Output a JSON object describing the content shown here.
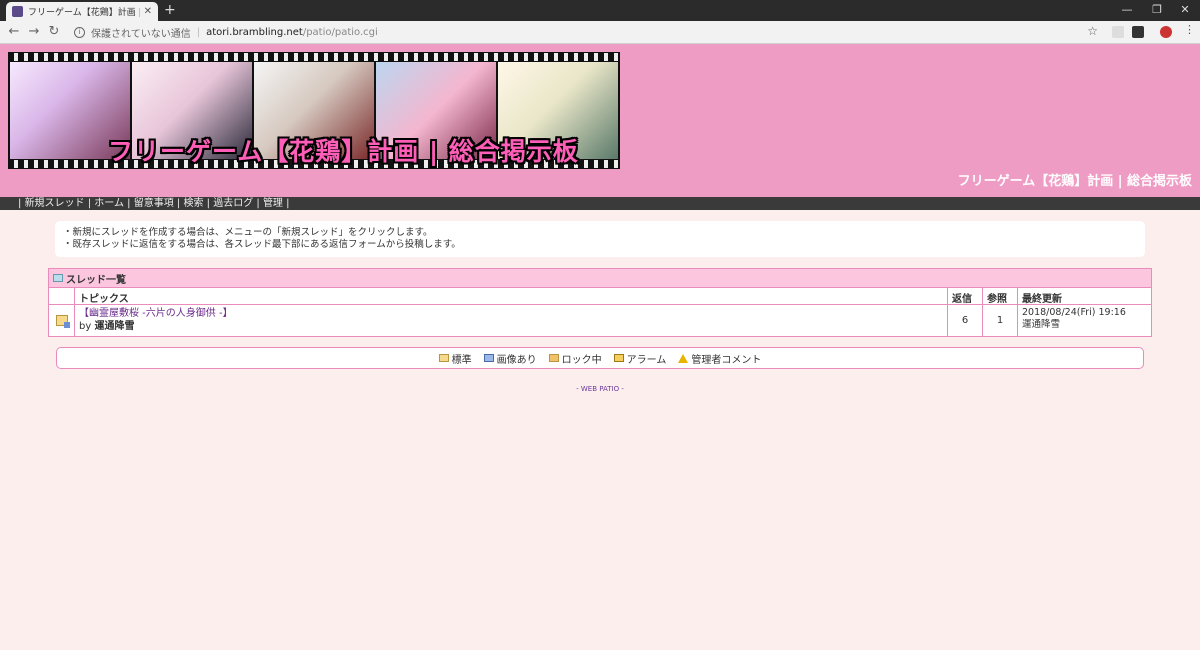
{
  "browser": {
    "tab_title": "フリーゲーム【花鶏】計画 | 総合掲示板",
    "security_text": "保護されていない通信",
    "url_host": "atori.brambling.net",
    "url_path": "/patio/patio.cgi"
  },
  "header": {
    "banner_title": "フリーゲーム【花鶏】計画 | 総合掲示板",
    "site_title": "フリーゲーム【花鶏】計画 | 総合掲示板"
  },
  "menu": {
    "items": [
      "新規スレッド",
      "ホーム",
      "留意事項",
      "検索",
      "過去ログ",
      "管理"
    ]
  },
  "notice": {
    "line1": "・新規にスレッドを作成する場合は、メニューの「新規スレッド」をクリックします。",
    "line2": "・既存スレッドに返信をする場合は、各スレッド最下部にある返信フォームから投稿します。"
  },
  "thread_list": {
    "title": "スレッド一覧",
    "columns": {
      "topic": "トピックス",
      "replies": "返信",
      "views": "参照",
      "updated": "最終更新"
    },
    "rows": [
      {
        "topic": "【幽霊屋敷桜 -六片の人身御供 -】",
        "by_prefix": "by",
        "author": "運通降雪",
        "replies": "6",
        "views": "1",
        "updated_date": "2018/08/24(Fri) 19:16",
        "updated_by": "運通降雪"
      }
    ]
  },
  "legend": {
    "items": [
      "標準",
      "画像あり",
      "ロック中",
      "アラーム",
      "管理者コメント"
    ]
  },
  "footer": {
    "text": "- WEB PATIO -"
  }
}
